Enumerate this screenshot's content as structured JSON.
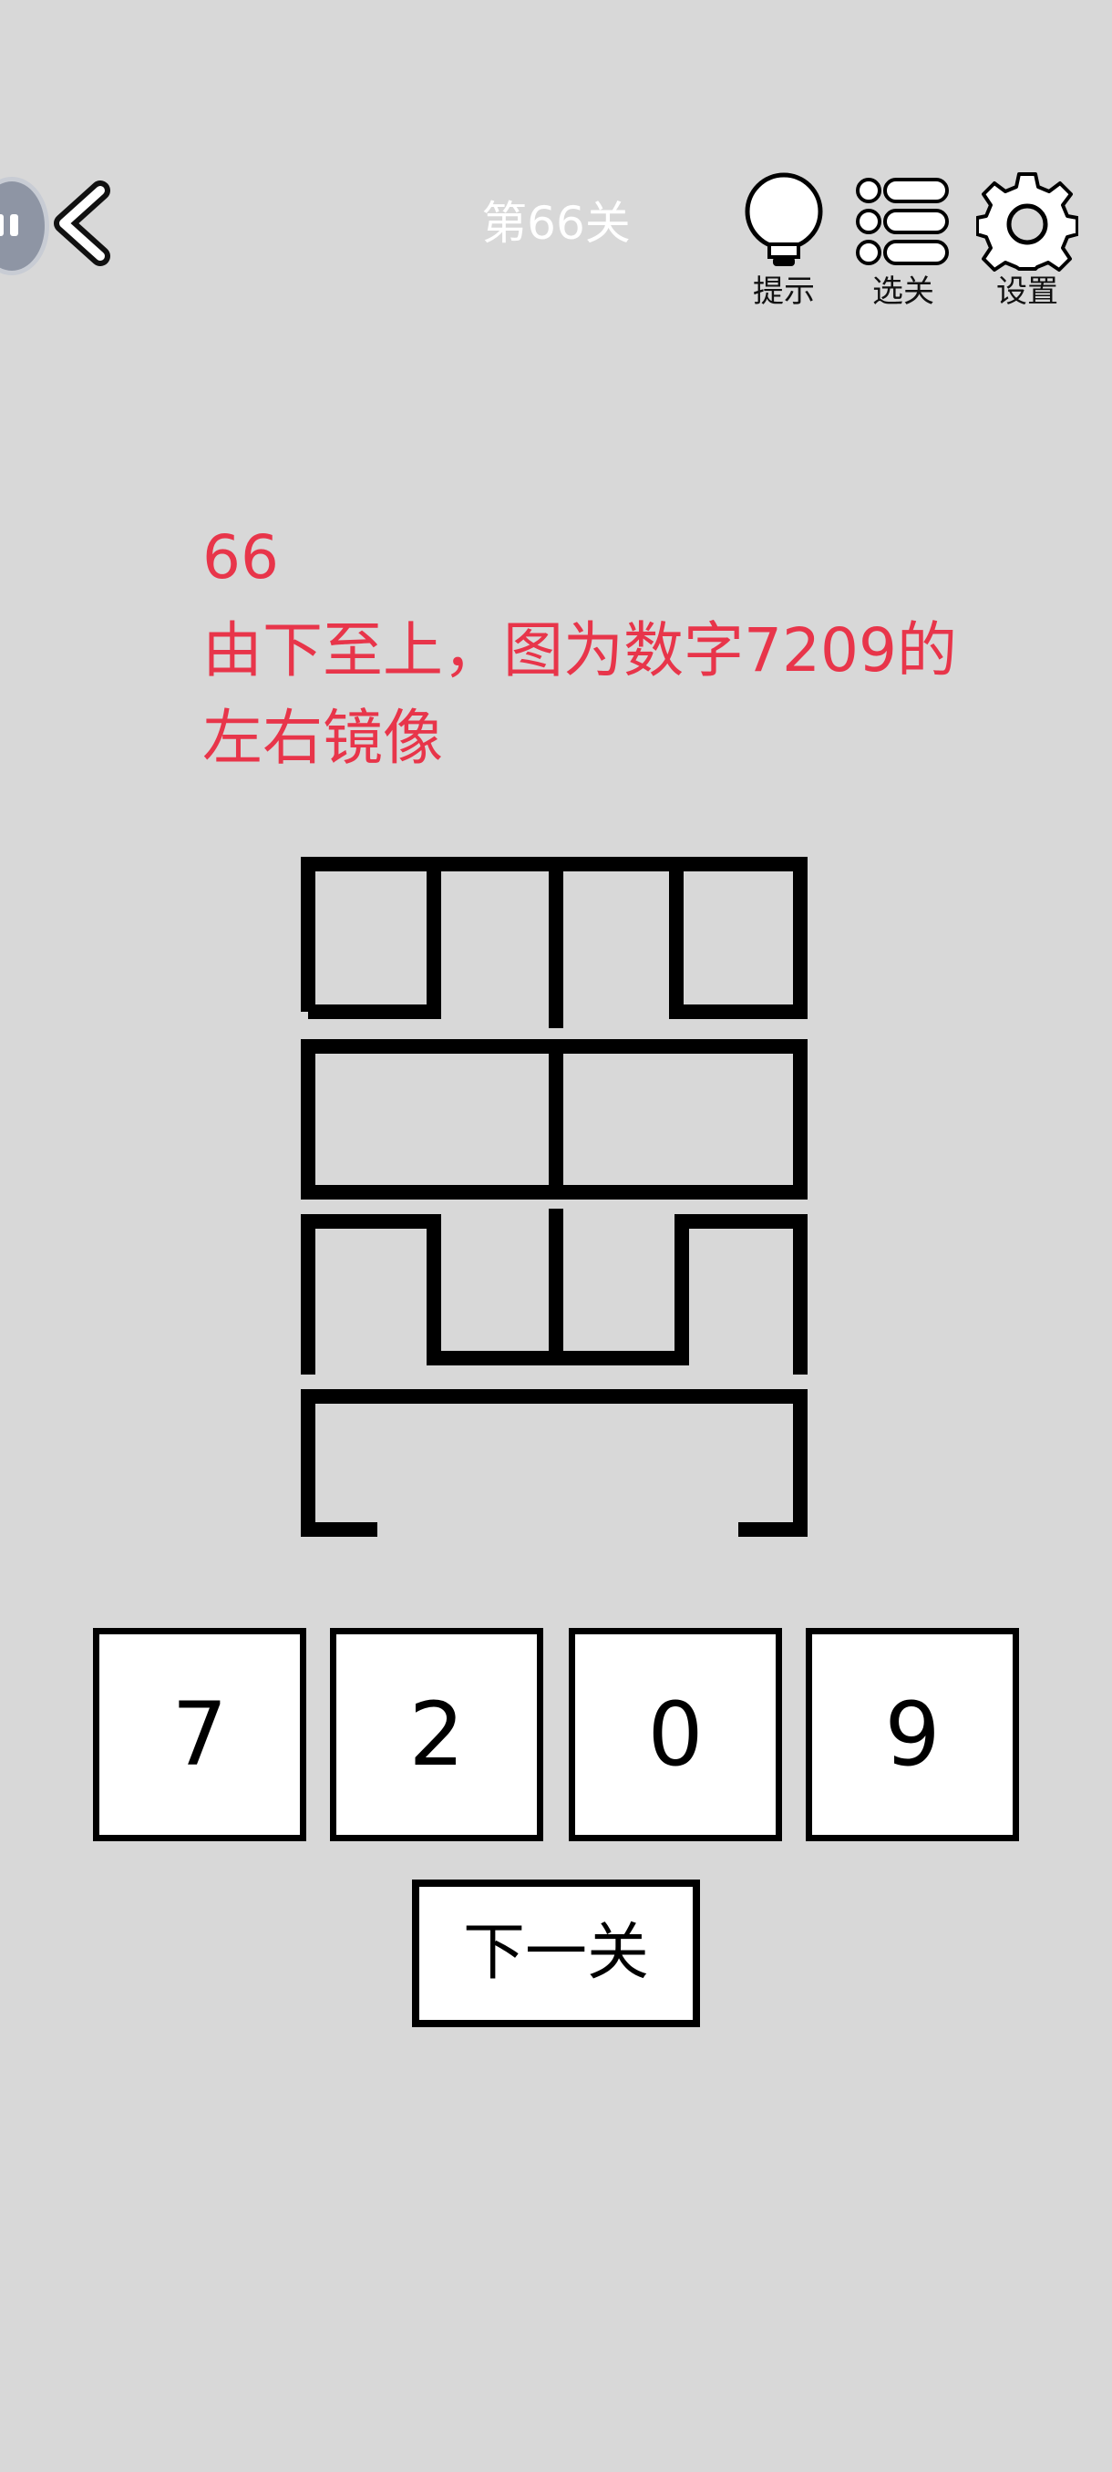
{
  "header": {
    "level_title": "第66关",
    "hint_label": "提示",
    "levels_label": "选关",
    "settings_label": "设置"
  },
  "question": {
    "number": "66",
    "line1": "由下至上，图为数字7209的",
    "line2": "左右镜像"
  },
  "answers": [
    "7",
    "2",
    "0",
    "9"
  ],
  "next_label": "下一关",
  "colors": {
    "background": "#d8d8d8",
    "question_text": "#e8354a",
    "title_text": "#ffffff"
  }
}
